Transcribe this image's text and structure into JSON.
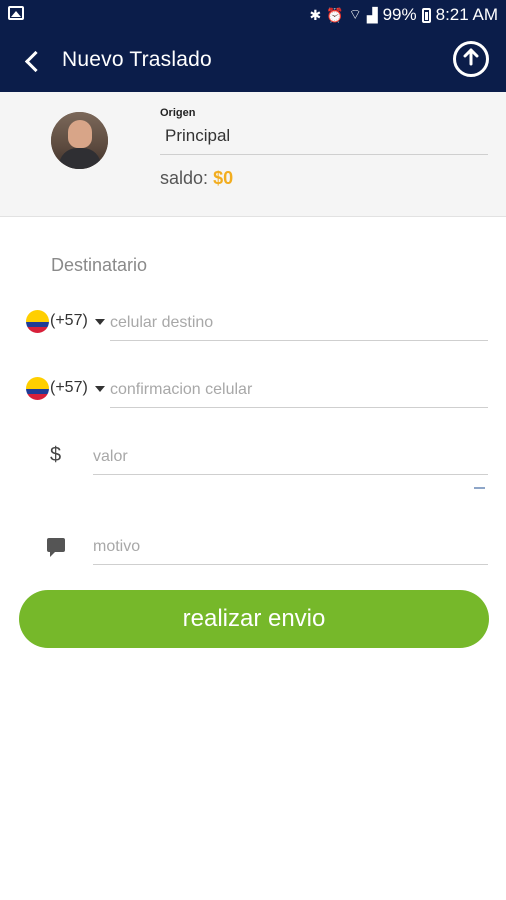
{
  "status_bar": {
    "battery": "99%",
    "time": "8:21 AM",
    "icons": [
      "image-icon",
      "bluetooth-icon",
      "alarm-icon",
      "wifi-icon",
      "signal-icon",
      "battery-icon"
    ]
  },
  "app_bar": {
    "title": "Nuevo Traslado",
    "back_icon": "chevron-left-icon",
    "action_icon": "logout-icon"
  },
  "origin": {
    "label": "Origen",
    "value": "Principal",
    "saldo_label": "saldo:",
    "saldo_amount": "$0"
  },
  "form": {
    "section_label": "Destinatario",
    "phone": {
      "country_code": "(+57)",
      "placeholder": "celular destino"
    },
    "confirm_phone": {
      "country_code": "(+57)",
      "placeholder": "confirmacion celular"
    },
    "amount": {
      "symbol": "$",
      "placeholder": "valor"
    },
    "reason": {
      "placeholder": "motivo"
    },
    "submit_label": "realizar envio"
  },
  "colors": {
    "header": "#0b1d4a",
    "accent_amount": "#f2ad1f",
    "submit": "#76b82a"
  }
}
